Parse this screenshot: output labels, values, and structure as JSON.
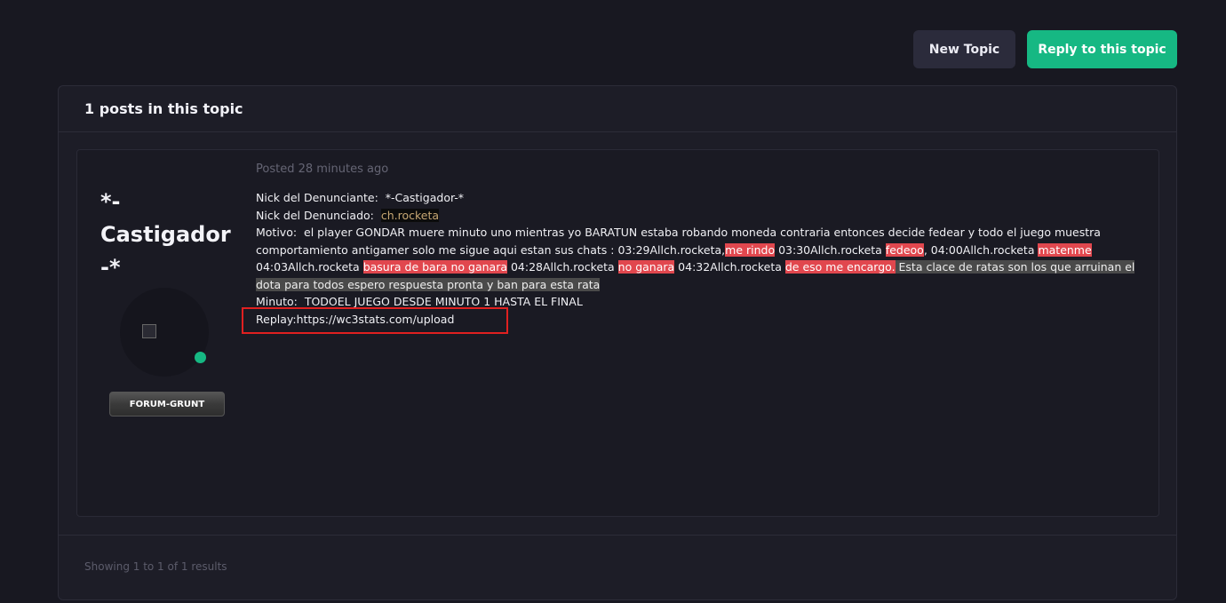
{
  "actions": {
    "new_topic": "New Topic",
    "reply": "Reply to this topic"
  },
  "panel": {
    "title": "1 posts in this topic"
  },
  "post": {
    "author": "*-Castigador-*",
    "rank": "FORUM-GRUNT",
    "posted": "Posted 28 minutes ago",
    "line1_label": "Nick del Denunciante:",
    "line1_value": "*-Castigador-*",
    "line2_label": "Nick del Denunciado:",
    "line2_value": "ch.rocketa",
    "motivo_label": "Motivo:",
    "motivo_text": "el player GONDAR muere minuto uno mientras yo BARATUN estaba robando moneda contraria entonces decide fedear y todo el juego muestra comportamiento antigamer solo me sigue aqui estan sus chats : 03:29Allch.rocketa,",
    "hl1": "me rindo",
    "t2": " 03:30Allch.rocketa ",
    "hl2": "fedeoo",
    "t3": ",  04:00Allch.rocketa ",
    "hl3": "matenme",
    "t4": " 04:03Allch.rocketa ",
    "hl4": "basura de bara no ganara",
    "t5": "   04:28Allch.rocketa ",
    "hl5": "no ganara",
    "t6": " 04:32Allch.rocketa ",
    "hl6": "de eso me encargo.",
    "hl7": " Esta clace de ratas son los que arruinan el dota para todos espero respuesta pronta y ban para esta rata",
    "minuto_label": "Minuto:",
    "minuto_text": "TODOEL JUEGO DESDE MINUTO 1 HASTA EL FINAL",
    "replay": "Replay:https://wc3stats.com/upload"
  },
  "footer": {
    "results": "Showing 1 to 1 of 1 results"
  },
  "colors": {
    "accent": "#16b883",
    "highlight_red": "#e1474e",
    "annotation_box": "#e02020"
  }
}
